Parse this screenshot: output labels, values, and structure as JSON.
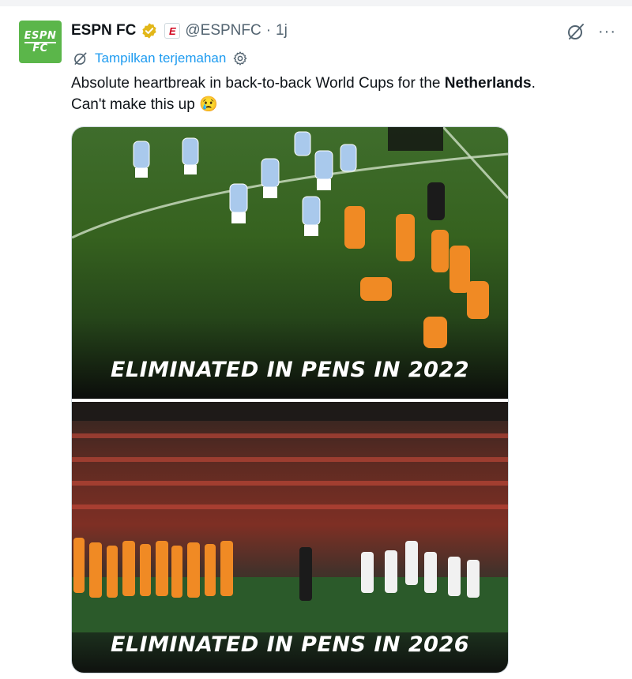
{
  "account": {
    "avatar_line1": "ESPN",
    "avatar_line2": "FC",
    "name": "ESPN FC",
    "handle": "@ESPNFC",
    "separator": "·",
    "time": "1j",
    "verified_icon": "verified-badge-gold",
    "affiliate_icon": "espn-e-logo",
    "affiliate_label": "E"
  },
  "actions": {
    "grok_icon": "grok-icon",
    "more_label": "···"
  },
  "translate": {
    "label": "Tampilkan terjemahan",
    "icon": "translate-icon",
    "settings_icon": "gear-icon"
  },
  "tweet": {
    "text_before": "Absolute heartbreak in back-to-back World Cups for the ",
    "text_bold": "Netherlands",
    "text_after": ".",
    "line2": "Can't make this up",
    "emoji": "😢"
  },
  "media": {
    "image1_caption": "ELIMINATED IN PENS IN 2022",
    "image2_caption": "ELIMINATED IN PENS IN 2026"
  },
  "colors": {
    "link": "#1d9bf0",
    "secondary_text": "#536471",
    "avatar_bg": "#5bb64a",
    "netherlands_orange": "#f08a24",
    "argentina_stripe": "#a9c9ec",
    "verified_gold": "#e2b719"
  }
}
